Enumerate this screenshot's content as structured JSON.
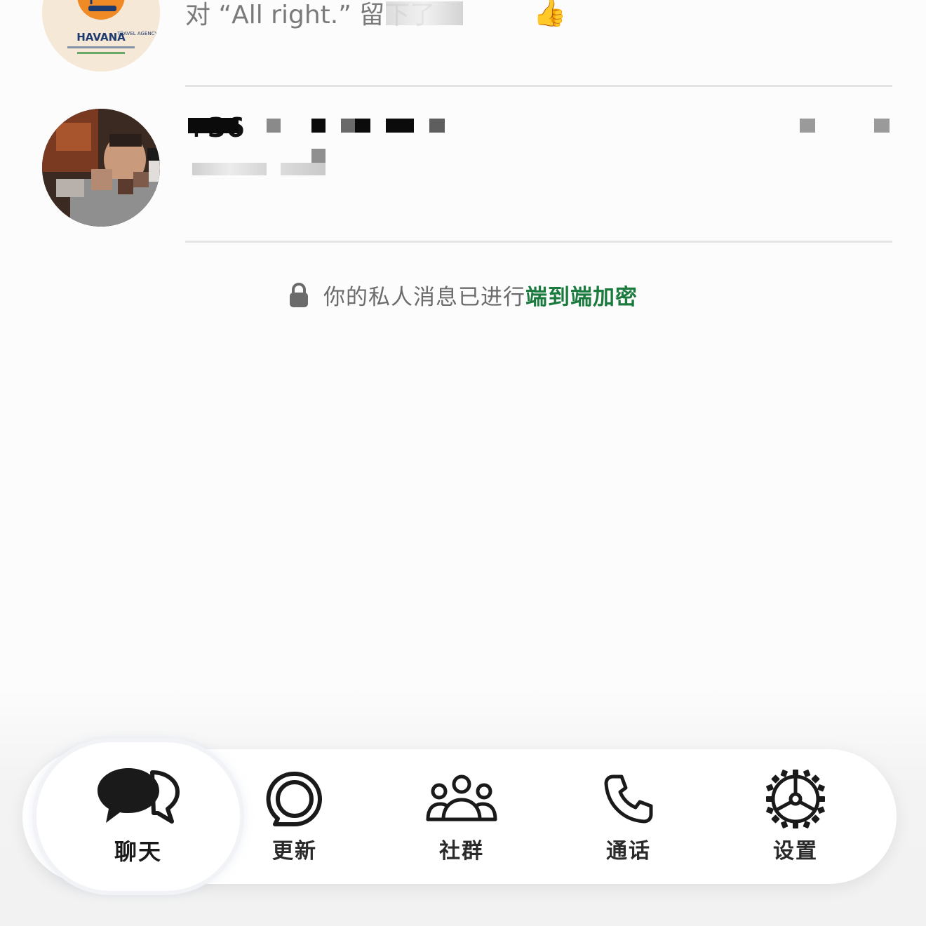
{
  "chats": [
    {
      "avatar_caption": "HAVANA",
      "avatar_subcaption": "TRAVEL AGENCY",
      "preview_text": "对 “All right.” 留下了",
      "reaction_emoji": "👍"
    },
    {
      "name_visible": "+36"
    }
  ],
  "encryption_notice": {
    "prefix": "你的私人消息已进行",
    "link": "端到端加密"
  },
  "tabs": [
    {
      "label": "聊天",
      "icon": "chats-icon",
      "active": true
    },
    {
      "label": "更新",
      "icon": "updates-icon",
      "active": false
    },
    {
      "label": "社群",
      "icon": "communities-icon",
      "active": false
    },
    {
      "label": "通话",
      "icon": "phone-icon",
      "active": false
    },
    {
      "label": "设置",
      "icon": "gear-icon",
      "active": false
    }
  ],
  "colors": {
    "accent_link": "#1b7a3e",
    "background": "#fcfcfc",
    "divider": "#e4e4e4"
  }
}
